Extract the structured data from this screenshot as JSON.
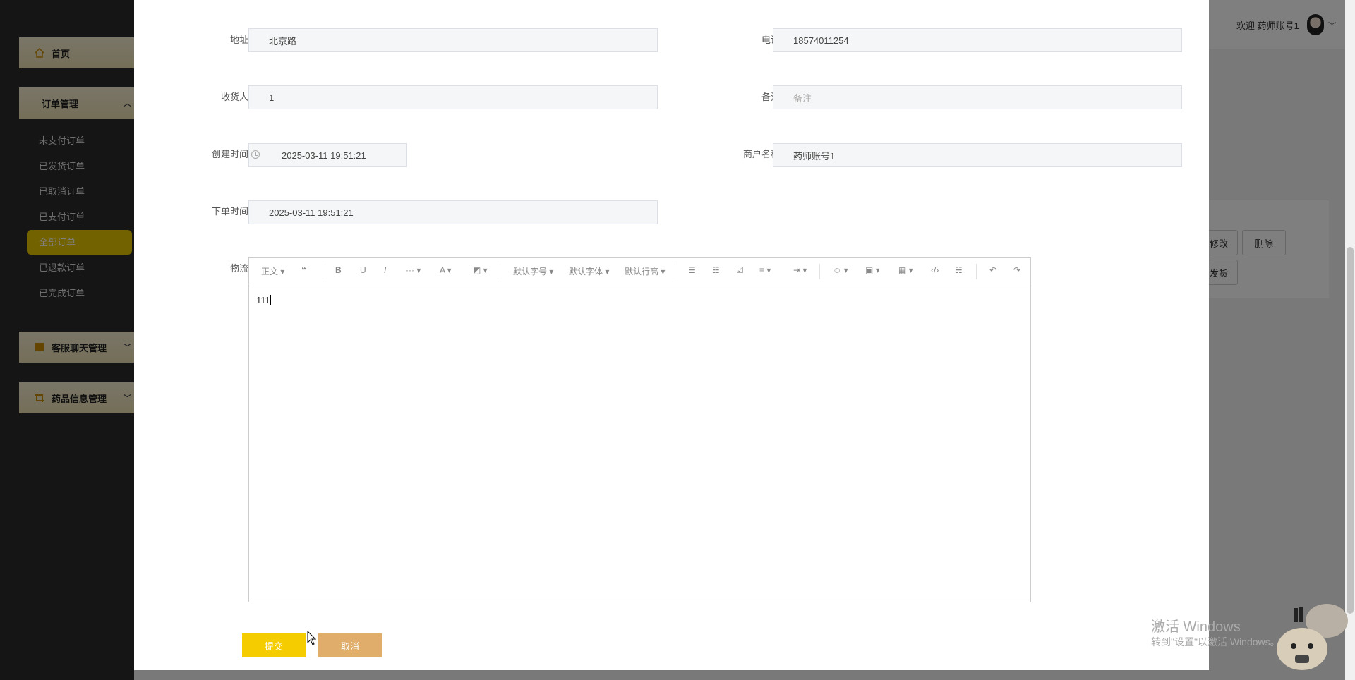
{
  "sidebar": {
    "home": "首页",
    "order_mgmt": "订单管理",
    "order_items": [
      "未支付订单",
      "已发货订单",
      "已取消订单",
      "已支付订单",
      "全部订单",
      "已退款订单",
      "已完成订单"
    ],
    "active_index": 4,
    "chat_mgmt": "客服聊天管理",
    "drug_mgmt": "药品信息管理"
  },
  "header": {
    "welcome": "欢迎 药师账号1"
  },
  "background_buttons": {
    "edit": "修改",
    "delete": "删除",
    "ship": "发货"
  },
  "form": {
    "address_label": "地址",
    "address_value": "北京路",
    "phone_label": "电话",
    "phone_value": "18574011254",
    "receiver_label": "收货人",
    "receiver_value": "1",
    "remark_label": "备注",
    "remark_placeholder": "备注",
    "created_label": "创建时间",
    "created_value": "2025-03-11 19:51:21",
    "merchant_label": "商户名称",
    "merchant_value": "药师账号1",
    "order_time_label": "下单时间",
    "order_time_value": "2025-03-11 19:51:21",
    "logistics_label": "物流"
  },
  "editor": {
    "toolbar": {
      "paragraph": "正文",
      "font_size": "默认字号",
      "font_family": "默认字体",
      "line_height": "默认行高"
    },
    "content": "111"
  },
  "actions": {
    "submit": "提交",
    "cancel": "取消"
  },
  "watermark": {
    "line1": "激活 Windows",
    "line2": "转到\"设置\"以激活 Windows。"
  },
  "colors": {
    "accent_yellow": "#f5cc00",
    "cancel_orange": "#e0ad6a",
    "sidebar_active": "#e5c400"
  }
}
